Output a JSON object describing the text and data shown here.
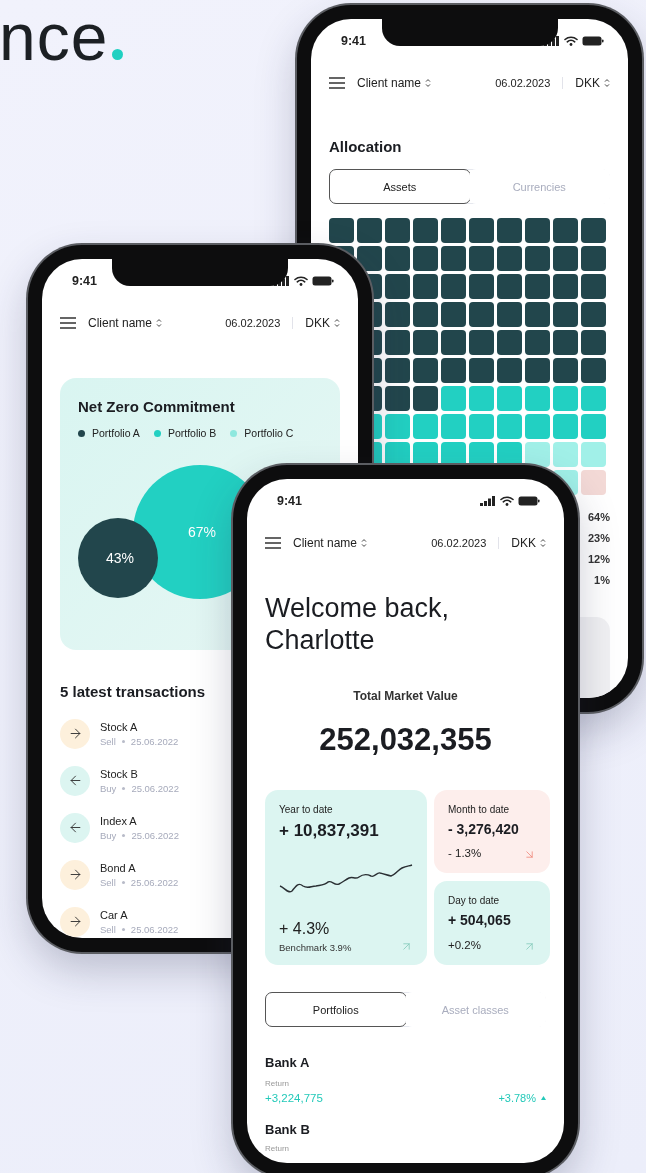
{
  "logo": {
    "text": "nce"
  },
  "phones": [
    {
      "kind": "allocation",
      "time": "9:41",
      "notch": true,
      "header": {
        "client": "Client name",
        "date": "06.02.2023",
        "currency": "DKK"
      },
      "title": "Allocation",
      "tabs": [
        {
          "label": "Assets",
          "selected": true
        },
        {
          "label": "Currencies",
          "selected": false
        }
      ],
      "segments": [
        {
          "label": "64%",
          "color": "#22464c"
        },
        {
          "label": "23%",
          "color": "#22d0c2"
        },
        {
          "label": "12%",
          "color": "#a1f0e8"
        },
        {
          "label": "1%",
          "color": "#f3d9d6"
        }
      ]
    },
    {
      "kind": "net_zero",
      "time": "9:41",
      "notch": true,
      "header": {
        "client": "Client name",
        "date": "06.02.2023",
        "currency": "DKK"
      },
      "card_title": "Net Zero Commitment",
      "legend": [
        {
          "label": "Portfolio A",
          "color": "#22464c"
        },
        {
          "label": "Portfolio B",
          "color": "#22d0c2"
        },
        {
          "label": "Portfolio C",
          "color": "#8ee8de"
        }
      ],
      "bubbles": [
        {
          "label": "67%",
          "color": "#22d0c2"
        },
        {
          "label": "43%",
          "color": "#22464c"
        }
      ],
      "list_title": "5 latest transactions",
      "transactions": [
        {
          "name": "Stock A",
          "type": "Sell",
          "date": "25.06.2022",
          "kind": "sell"
        },
        {
          "name": "Stock B",
          "type": "Buy",
          "date": "25.06.2022",
          "kind": "buy"
        },
        {
          "name": "Index A",
          "type": "Buy",
          "date": "25.06.2022",
          "kind": "buy"
        },
        {
          "name": "Bond A",
          "type": "Sell",
          "date": "25.06.2022",
          "kind": "sell"
        },
        {
          "name": "Car A",
          "type": "Sell",
          "date": "25.06.2022",
          "kind": "sell"
        }
      ]
    },
    {
      "kind": "overview",
      "time": "9:41",
      "notch": false,
      "header": {
        "client": "Client name",
        "date": "06.02.2023",
        "currency": "DKK"
      },
      "greeting": "Welcome back, Charlotte",
      "total_label": "Total Market Value",
      "total_value": "252,032,355",
      "cards": [
        {
          "kind": "chart",
          "label": "Year to date",
          "value": "+ 10,837,391",
          "change": "+ 4.3%",
          "note": "Benchmark 3.9%",
          "negative": false
        },
        {
          "kind": "plain",
          "label": "Month to date",
          "value": "- 3,276,420",
          "change": "- 1.3%",
          "negative": true
        },
        {
          "kind": "plain",
          "label": "Day to date",
          "value": "+ 504,065",
          "change": "+0.2%",
          "negative": false
        }
      ],
      "tabs": [
        {
          "label": "Portfolios",
          "selected": true
        },
        {
          "label": "Asset classes",
          "selected": false
        }
      ],
      "banks": [
        {
          "name": "Bank A",
          "return_label": "Return",
          "amount": "+3,224,775",
          "percent": "+3.78%",
          "negative": false
        },
        {
          "name": "Bank B",
          "return_label": "Return"
        }
      ]
    }
  ]
}
